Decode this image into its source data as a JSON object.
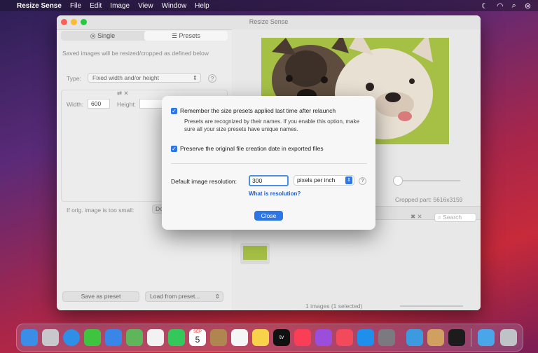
{
  "menubar": {
    "app_name": "Resize Sense",
    "items": [
      "File",
      "Edit",
      "Image",
      "View",
      "Window",
      "Help"
    ],
    "status_icons": [
      "moon-icon",
      "wifi-icon",
      "search-icon",
      "control-center-icon"
    ]
  },
  "window": {
    "title": "Resize Sense",
    "tabs": {
      "single": "Single",
      "presets": "Presets"
    },
    "info_text": "Saved images will be resized/cropped as defined below",
    "type_label": "Type:",
    "type_value": "Fixed width and/or height",
    "width_label": "Width:",
    "width_value": "600",
    "height_label": "Height:",
    "small_label": "If orig. image is too small:",
    "small_value": "Do",
    "save_preset": "Save as preset",
    "load_preset": "Load from preset...",
    "cropped_part": "Cropped part: 5616x3159",
    "search_placeholder": "Search",
    "status": "1 images (1 selected)"
  },
  "dialog": {
    "remember_label": "Remember the size presets applied last time after relaunch",
    "remember_note": "Presets are recognized by their names. If you enable this option, make sure all your size presets have unique names.",
    "preserve_label": "Preserve the original file creation date in exported files",
    "resolution_label": "Default image resolution:",
    "resolution_value": "300",
    "unit_value": "pixels per inch",
    "help_link": "What is resolution?",
    "close_button": "Close",
    "help_mark": "?"
  },
  "dock": {
    "calendar_month": "SEP",
    "calendar_day": "5",
    "tv_label": "tv"
  },
  "colors": {
    "accent": "#2d76e6",
    "link": "#1f5fcf",
    "traffic_red": "#fe5f57",
    "traffic_yellow": "#febc2e",
    "traffic_green": "#28c840"
  }
}
